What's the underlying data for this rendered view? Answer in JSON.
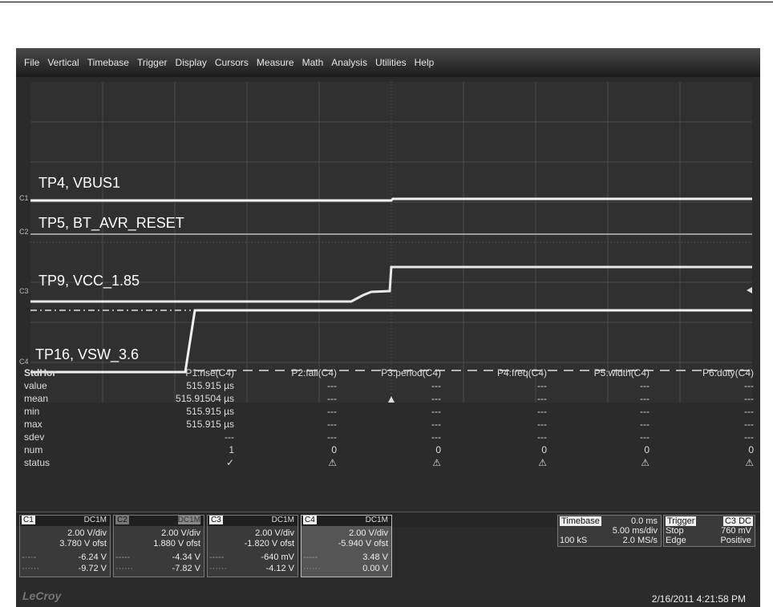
{
  "menu": [
    "File",
    "Vertical",
    "Timebase",
    "Trigger",
    "Display",
    "Cursors",
    "Measure",
    "Math",
    "Analysis",
    "Utilities",
    "Help"
  ],
  "traces": [
    {
      "marker": "C1",
      "label": "TP4, VBUS1"
    },
    {
      "marker": "C2",
      "label": "TP5, BT_AVR_RESET"
    },
    {
      "marker": "C3",
      "label": "TP9, VCC_1.85"
    },
    {
      "marker": "C4",
      "label": "TP16, VSW_3.6"
    }
  ],
  "measure": {
    "header": "StdHor",
    "columns": [
      "P1:rise(C4)",
      "P2:fall(C4)",
      "P3:period(C4)",
      "P4:freq(C4)",
      "P5:width(C4)",
      "P6:duty(C4)"
    ],
    "rows": [
      {
        "name": "value",
        "cells": [
          "515.915 µs",
          "---",
          "---",
          "---",
          "---",
          "---"
        ]
      },
      {
        "name": "mean",
        "cells": [
          "515.91504 µs",
          "---",
          "---",
          "---",
          "---",
          "---"
        ]
      },
      {
        "name": "min",
        "cells": [
          "515.915 µs",
          "---",
          "---",
          "---",
          "---",
          "---"
        ]
      },
      {
        "name": "max",
        "cells": [
          "515.915 µs",
          "---",
          "---",
          "---",
          "---",
          "---"
        ]
      },
      {
        "name": "sdev",
        "cells": [
          "---",
          "---",
          "---",
          "---",
          "---",
          "---"
        ]
      },
      {
        "name": "num",
        "cells": [
          "1",
          "0",
          "0",
          "0",
          "0",
          "0"
        ]
      },
      {
        "name": "status",
        "cells": [
          "✓",
          "⚠",
          "⚠",
          "⚠",
          "⚠",
          "⚠"
        ]
      }
    ],
    "histo": "histo"
  },
  "channels": [
    {
      "name": "C1",
      "coupling": "DC1M",
      "vdiv": "2.00 V/div",
      "ofst": "3.780 V ofst",
      "a": "-6.24 V",
      "b": "-9.72 V"
    },
    {
      "name": "C2",
      "coupling": "DC1M",
      "vdiv": "2.00 V/div",
      "ofst": "1.880 V ofst",
      "a": "-4.34 V",
      "b": "-7.82 V"
    },
    {
      "name": "C3",
      "coupling": "DC1M",
      "vdiv": "2.00 V/div",
      "ofst": "-1.820 V ofst",
      "a": "-640 mV",
      "b": "-4.12 V"
    },
    {
      "name": "C4",
      "coupling": "DC1M",
      "vdiv": "2.00 V/div",
      "ofst": "-5.940 V ofst",
      "a": "3.48 V",
      "b": "0.00 V"
    }
  ],
  "timebase": {
    "label": "Timebase",
    "delay": "0.0 ms",
    "tdiv": "5.00 ms/div",
    "samples": "100 kS",
    "rate": "2.0 MS/s"
  },
  "trigger": {
    "label": "Trigger",
    "source": "C3 DC",
    "mode": "Stop",
    "level": "760 mV",
    "type": "Edge",
    "slope": "Positive"
  },
  "brand": "LeCroy",
  "datetime": "2/16/2011 4:21:58 PM"
}
